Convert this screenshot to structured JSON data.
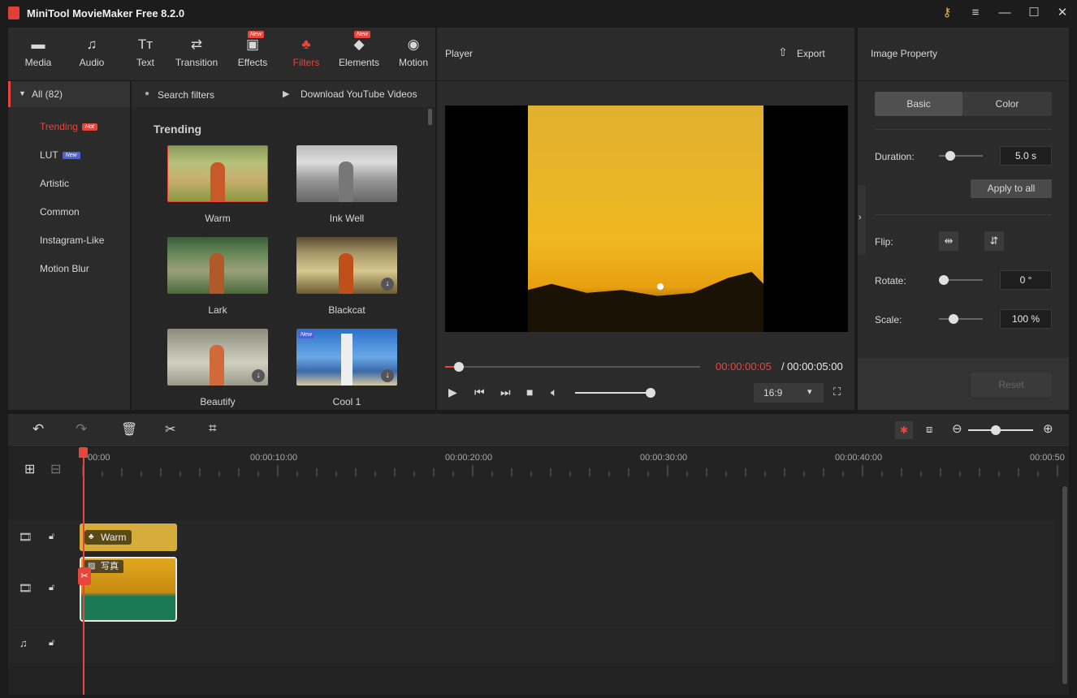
{
  "window": {
    "title": "MiniTool MovieMaker Free 8.2.0"
  },
  "toolbar": {
    "items": [
      {
        "label": "Media",
        "icon": "media-icon"
      },
      {
        "label": "Audio",
        "icon": "audio-icon"
      },
      {
        "label": "Text",
        "icon": "text-icon"
      },
      {
        "label": "Transition",
        "icon": "transition-icon"
      },
      {
        "label": "Effects",
        "icon": "effects-icon",
        "badge": "New"
      },
      {
        "label": "Filters",
        "icon": "filters-icon",
        "active": true
      },
      {
        "label": "Elements",
        "icon": "elements-icon",
        "badge": "New"
      },
      {
        "label": "Motion",
        "icon": "motion-icon"
      }
    ]
  },
  "categories": {
    "all_label": "All (82)",
    "items": [
      {
        "label": "Trending",
        "badge": "Hot",
        "active": true
      },
      {
        "label": "LUT",
        "badge": "New"
      },
      {
        "label": "Artistic"
      },
      {
        "label": "Common"
      },
      {
        "label": "Instagram-Like"
      },
      {
        "label": "Motion Blur"
      }
    ]
  },
  "filters": {
    "search_placeholder": "Search filters",
    "download_label": "Download YouTube Videos",
    "section_title": "Trending",
    "items": [
      "Warm",
      "Ink Well",
      "Lark",
      "Blackcat",
      "Beautify",
      "Cool 1"
    ],
    "new_badge": "New"
  },
  "player": {
    "title": "Player",
    "export_label": "Export",
    "current_time": "00:00:00:05",
    "separator": "/",
    "total_time": "00:00:05:00",
    "aspect": "16:9"
  },
  "property": {
    "title": "Image Property",
    "tab_basic": "Basic",
    "tab_color": "Color",
    "duration_label": "Duration:",
    "duration_value": "5.0 s",
    "apply_all": "Apply to all",
    "flip_label": "Flip:",
    "rotate_label": "Rotate:",
    "rotate_value": "0 °",
    "scale_label": "Scale:",
    "scale_value": "100 %",
    "reset_label": "Reset"
  },
  "timeline": {
    "ruler": [
      "00:00",
      "00:00:10:00",
      "00:00:20:00",
      "00:00:30:00",
      "00:00:40:00",
      "00:00:50"
    ],
    "filter_clip": "Warm",
    "image_clip": "写真"
  },
  "colors": {
    "accent": "#e8453c",
    "clip_filter": "#d6ad3a",
    "clip_image_bottom": "#1a7a55"
  }
}
